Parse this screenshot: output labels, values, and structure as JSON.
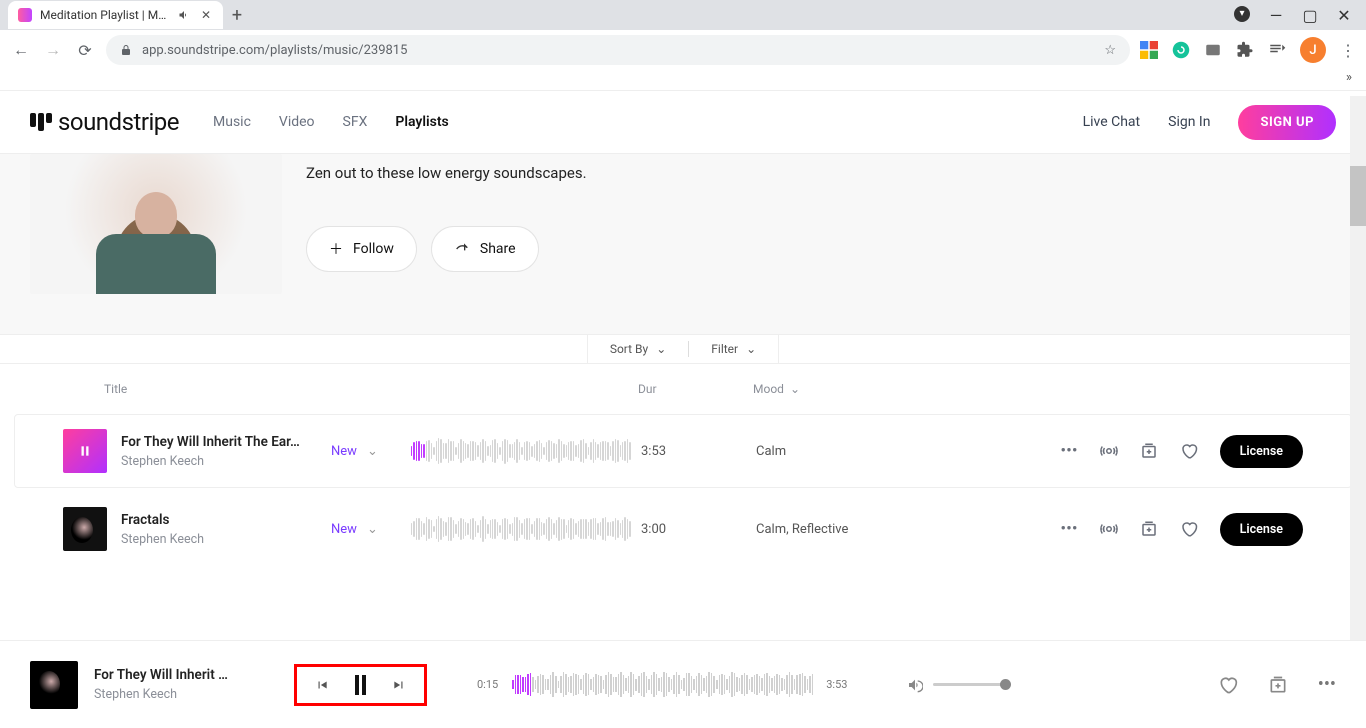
{
  "browser": {
    "tab_title": "Meditation Playlist | Music Li",
    "url": "app.soundstripe.com/playlists/music/239815",
    "avatar_letter": "J"
  },
  "header": {
    "brand": "soundstripe",
    "nav": {
      "music": "Music",
      "video": "Video",
      "sfx": "SFX",
      "playlists": "Playlists"
    },
    "live_chat": "Live Chat",
    "sign_in": "Sign In",
    "sign_up": "SIGN UP"
  },
  "playlist": {
    "description": "Zen out to these low energy soundscapes.",
    "follow": "Follow",
    "share": "Share"
  },
  "toolbar": {
    "sort": "Sort By",
    "filter": "Filter"
  },
  "columns": {
    "title": "Title",
    "dur": "Dur",
    "mood": "Mood"
  },
  "tracks": [
    {
      "title": "For They Will Inherit The Ear…",
      "artist": "Stephen Keech",
      "tag": "New",
      "duration": "3:53",
      "mood": "Calm",
      "license": "License",
      "playing": true
    },
    {
      "title": "Fractals",
      "artist": "Stephen Keech",
      "tag": "New",
      "duration": "3:00",
      "mood": "Calm, Reflective",
      "license": "License",
      "playing": false
    }
  ],
  "player": {
    "title": "For They Will Inherit …",
    "artist": "Stephen Keech",
    "elapsed": "0:15",
    "total": "3:53"
  }
}
